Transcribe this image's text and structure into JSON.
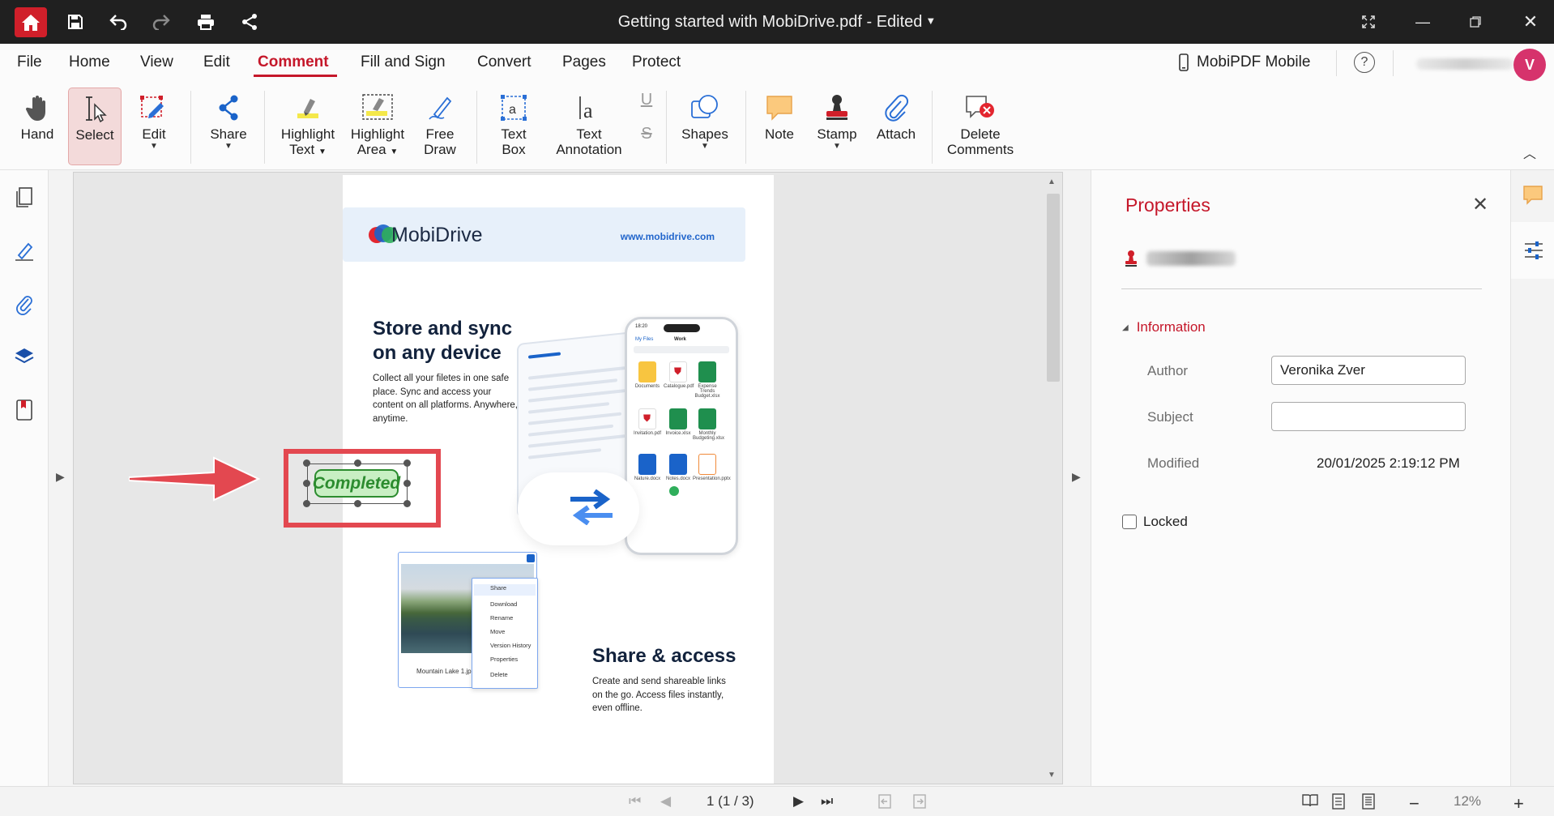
{
  "titlebar": {
    "title": "Getting started with MobiDrive.pdf - Edited",
    "icons": [
      "home-icon",
      "save-icon",
      "undo-icon",
      "redo-icon",
      "print-icon",
      "share-icon"
    ],
    "window_controls": [
      "fullscreen-icon",
      "minimize-icon",
      "restore-icon",
      "close-icon"
    ]
  },
  "menu": {
    "items": [
      "File",
      "Home",
      "View",
      "Edit",
      "Comment",
      "Fill and Sign",
      "Convert",
      "Pages",
      "Protect"
    ],
    "active": "Comment",
    "mobile_label": "MobiPDF Mobile",
    "help": "?",
    "avatar_initial": "V"
  },
  "ribbon": {
    "hand": "Hand",
    "select": "Select",
    "edit": "Edit",
    "share": "Share",
    "highlight_text_1": "Highlight",
    "highlight_text_2": "Text",
    "highlight_area_1": "Highlight",
    "highlight_area_2": "Area",
    "free_draw_1": "Free",
    "free_draw_2": "Draw",
    "text_box_1": "Text",
    "text_box_2": "Box",
    "text_annotation_1": "Text",
    "text_annotation_2": "Annotation",
    "underline": "U",
    "strikethrough": "S",
    "shapes": "Shapes",
    "note": "Note",
    "stamp": "Stamp",
    "attach": "Attach",
    "delete_comments_1": "Delete",
    "delete_comments_2": "Comments"
  },
  "document": {
    "brand": "MobiDrive",
    "brand_url": "www.mobidrive.com",
    "heading_store_1": "Store and sync",
    "heading_store_2": "on any device",
    "body_store": "Collect all your filetes in one safe place. Sync and access your content on all platforms. Anywhere, anytime.",
    "heading_share": "Share & access",
    "body_share": "Create and send shareable links on the go. Access files instantly, even offline.",
    "photo_label": "Mountain Lake 1.jpeg",
    "context_menu": [
      "Share",
      "Download",
      "Rename",
      "Move",
      "Version History",
      "Properties",
      "Delete"
    ],
    "phone_header": "Work",
    "phone_back": "My Files",
    "phone_time": "18:20",
    "phone_files": [
      "Documents",
      "Catalogue.pdf",
      "Expense Trends Budget.xlsx",
      "Invitation.pdf",
      "Invoice.xlsx",
      "Monthly Budgeting.xlsx",
      "Nature.docx",
      "Notes.docx",
      "Presentation.pptx"
    ],
    "stamp_text": "Completed"
  },
  "properties": {
    "title": "Properties",
    "section": "Information",
    "author_label": "Author",
    "author_value": "Veronika Zver",
    "subject_label": "Subject",
    "subject_value": "",
    "modified_label": "Modified",
    "modified_value": "20/01/2025 2:19:12 PM",
    "locked_label": "Locked"
  },
  "statusbar": {
    "page_indicator": "1 (1 / 3)",
    "zoom": "12%",
    "zoom_out": "−",
    "zoom_in": "+"
  },
  "colors": {
    "accent": "#c5172a",
    "titlebar": "#202020",
    "annotation_red": "#e34850",
    "stamp_green": "#2c8c2f"
  }
}
